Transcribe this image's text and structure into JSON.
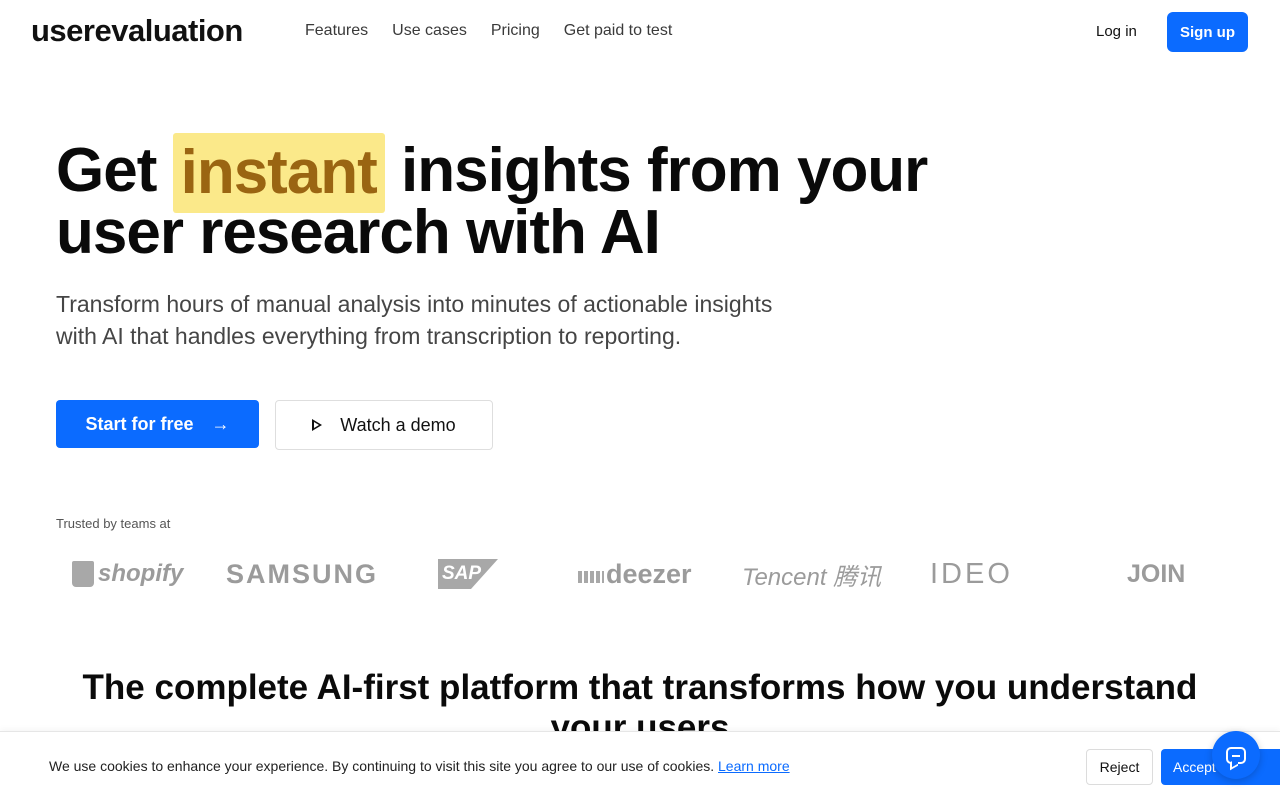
{
  "header": {
    "logo": "userevaluation",
    "nav": [
      "Features",
      "Use cases",
      "Pricing",
      "Get paid to test"
    ],
    "login_label": "Log in",
    "signup_label": "Sign up"
  },
  "hero": {
    "title_before": "Get ",
    "title_highlight": "instant",
    "title_after": " insights from your",
    "title_line2": "user research with AI",
    "subtitle_line1": "Transform hours of manual analysis into minutes of actionable insights",
    "subtitle_line2": "with AI that handles everything from transcription to reporting.",
    "cta_primary": "Start for free",
    "cta_primary_icon": "→",
    "cta_secondary": "Watch a demo"
  },
  "trusted": {
    "label": "Trusted by teams at",
    "logos": [
      "shopify",
      "SAMSUNG",
      "SAP",
      "deezer",
      "Tencent 腾讯",
      "IDEO",
      "JOIN"
    ]
  },
  "section": {
    "title_line1": "The complete AI-first platform that transforms how you understand",
    "title_line2": "your users"
  },
  "cookie": {
    "text": "We use cookies to enhance your experience. By continuing to visit this site you agree to our use of cookies.",
    "learn_more": "Learn more",
    "reject": "Reject",
    "accept": "Accept"
  },
  "colors": {
    "brand_blue": "#0b6bff",
    "highlight_bg": "#fbe98a",
    "highlight_text": "#9a6512"
  },
  "icons": {
    "arrow": "arrow-right-icon",
    "play": "play-icon",
    "chat": "chat-icon"
  }
}
